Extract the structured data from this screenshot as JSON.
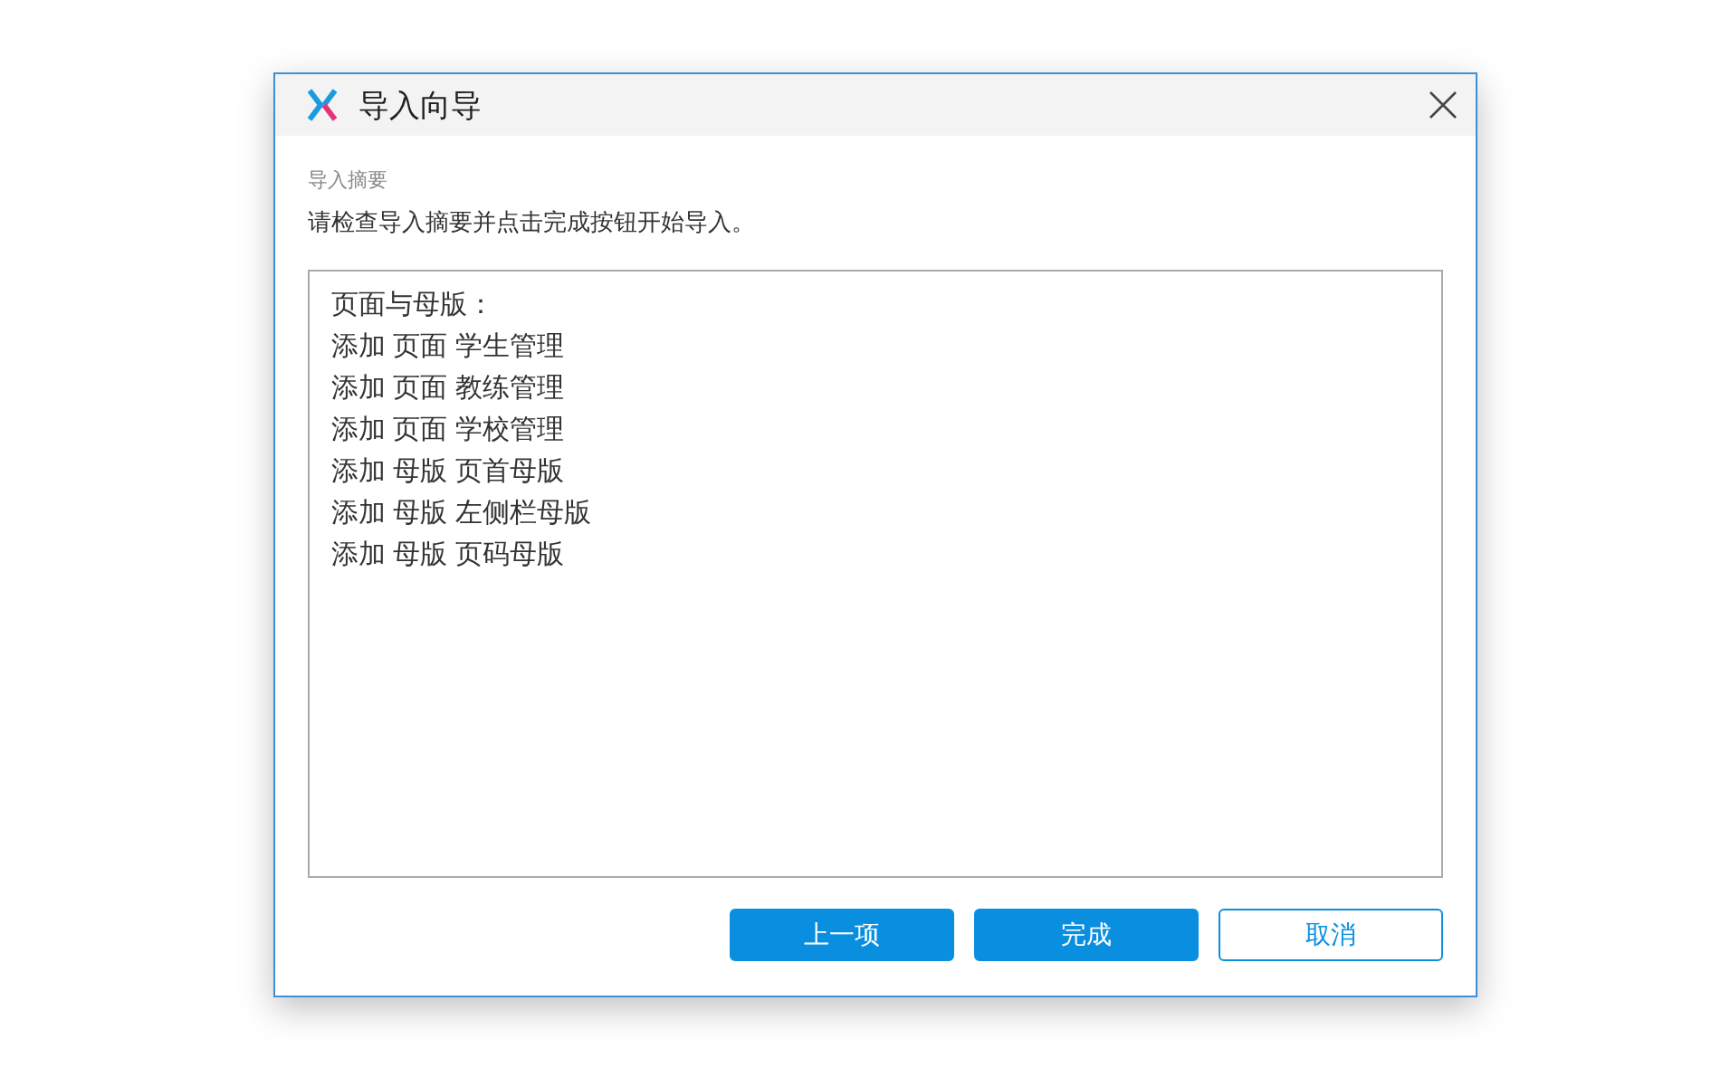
{
  "window": {
    "title": "导入向导"
  },
  "section_label": "导入摘要",
  "instruction": "请检查导入摘要并点击完成按钮开始导入。",
  "summary_lines": [
    "页面与母版：",
    "添加 页面 学生管理",
    "添加 页面 教练管理",
    "添加 页面 学校管理",
    "添加 母版 页首母版",
    "添加 母版 左侧栏母版",
    "添加 母版 页码母版"
  ],
  "buttons": [
    {
      "label": "上一项",
      "kind": "primary"
    },
    {
      "label": "完成",
      "kind": "primary"
    },
    {
      "label": "取消",
      "kind": "secondary"
    }
  ]
}
